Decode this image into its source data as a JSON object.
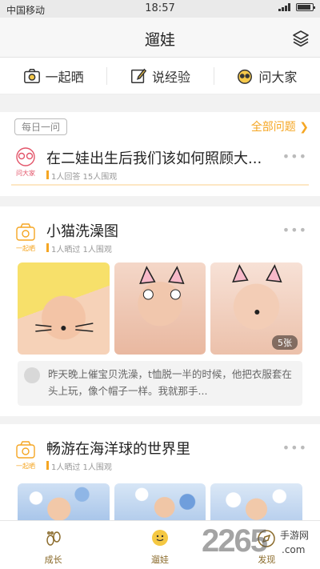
{
  "status_bar": {
    "carrier": "中国移动",
    "time": "18:57"
  },
  "header": {
    "title": "遛娃",
    "menu_icon": "layers-icon"
  },
  "actions": [
    {
      "label": "一起晒",
      "icon": "camera-icon"
    },
    {
      "label": "说经验",
      "icon": "pencil-icon"
    },
    {
      "label": "问大家",
      "icon": "question-face-icon"
    }
  ],
  "daily": {
    "tag": "每日一问",
    "all_link": "全部问题",
    "icon_label": "问大家",
    "title": "在二娃出生后我们该如何照顾大...",
    "meta": "1人回答  15人围观",
    "more": "•••"
  },
  "post1": {
    "icon_label": "一起晒",
    "title": "小猫洗澡图",
    "meta": "1人晒过  1人围观",
    "more": "•••",
    "photo_count": "5张",
    "comment": "昨天晚上催宝贝洗澡，t恤脱一半的时候，他把衣服套在头上玩，像个帽子一样。我就那手..."
  },
  "post2": {
    "icon_label": "一起晒",
    "title": "畅游在海洋球的世界里",
    "meta": "1人晒过  1人围观",
    "more": "•••"
  },
  "tabs": [
    {
      "label": "成长",
      "icon": "footprint-icon"
    },
    {
      "label": "遛娃",
      "icon": "smile-bubble-icon"
    },
    {
      "label": "发现",
      "icon": "compass-icon"
    }
  ],
  "watermark": {
    "number": "2265",
    "site": "手游网",
    "domain": ".com"
  },
  "colors": {
    "accent": "#f5a623",
    "background": "#f2f2f2"
  }
}
